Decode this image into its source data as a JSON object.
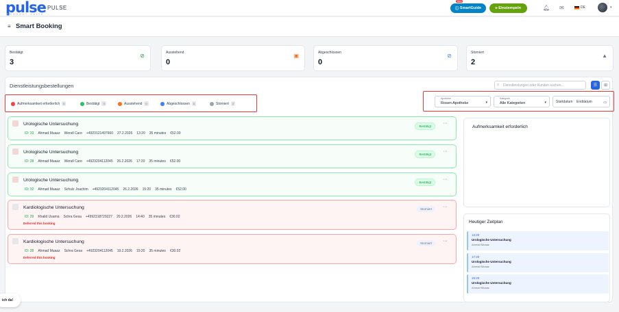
{
  "header": {
    "logo": "pulse",
    "logo_sub": "PRODUCT SUITE",
    "app_name": "PULSE",
    "new_badge": "Neu",
    "smartguide_label": "SmartGuide",
    "einstempeln_label": "Einstempeln",
    "language": "DE",
    "page_title": "Smart Booking"
  },
  "stats": [
    {
      "label": "Bestätigt",
      "value": "3",
      "icon": "check-circle-icon",
      "color": "#16a34a"
    },
    {
      "label": "Ausstehend",
      "value": "0",
      "icon": "calendar-pending-icon",
      "color": "#f97316"
    },
    {
      "label": "Abgeschlossen",
      "value": "0",
      "icon": "check-circle-icon",
      "color": "#3b82f6"
    },
    {
      "label": "Storniert",
      "value": "2",
      "icon": "warning-triangle-icon",
      "color": "#6b7280"
    }
  ],
  "section": {
    "title": "Dienstleistungsbestellungen",
    "search_placeholder": "Dienstleistungen oder Kunden suchen..."
  },
  "legend": [
    {
      "label": "Aufmerksamkeit erforderlich",
      "count": "0",
      "color": "#ef4444"
    },
    {
      "label": "Bestätigt",
      "count": "3",
      "color": "#22c55e"
    },
    {
      "label": "Ausstehend",
      "count": "0",
      "color": "#f97316"
    },
    {
      "label": "Abgeschlossen",
      "count": "0",
      "color": "#3b82f6"
    },
    {
      "label": "Storniert",
      "count": "2",
      "color": "#9ca3af"
    }
  ],
  "filters": {
    "pharmacy_label": "Apotheke",
    "pharmacy_value": "Rosen Apotheke",
    "category_label": "Kategorie",
    "category_value": "Alle Kategorien",
    "start_placeholder": "Startdatum",
    "end_placeholder": "Enddatum"
  },
  "bookings": [
    {
      "title": "Urologische Untersuchung",
      "id": "ID: 33",
      "user": "Ahmad Muaaz",
      "patient": "Wendl Caro",
      "phone": "+4923121497660",
      "date": "27.2.2026",
      "time": "13:20",
      "duration": "35 minutes",
      "price": "€52.00",
      "status": "Bestätigt",
      "note": ""
    },
    {
      "title": "Urologische Untersuchung",
      "id": "ID: 38",
      "user": "Ahmad Muaaz",
      "patient": "Wendl Caro",
      "phone": "+4923204112045",
      "date": "26.2.2026",
      "time": "17:20",
      "duration": "35 minutes",
      "price": "€52.00",
      "status": "Bestätigt",
      "note": ""
    },
    {
      "title": "Urologische Untersuchung",
      "id": "ID: 32",
      "user": "Ahmad Muaaz",
      "patient": "Schulz Joachim",
      "phone": "+4923204112045",
      "date": "26.2.2026",
      "time": "15:20",
      "duration": "35 minutes",
      "price": "€52.00",
      "status": "Bestätigt",
      "note": ""
    },
    {
      "title": "Kardiologische Untersuchung",
      "id": "ID: 29",
      "user": "Khalid Usama",
      "patient": "Schra Gesa",
      "phone": "+4992318729227",
      "date": "20.2.2026",
      "time": "14:40",
      "duration": "35 minutes",
      "price": "€30.02",
      "status": "Storniert",
      "note": "Deferred this booking"
    },
    {
      "title": "Kardiologische Untersuchung",
      "id": "ID: 28",
      "user": "Ahmad Muaaz",
      "patient": "Schra Gesa",
      "phone": "+4923204112045",
      "date": "19.2.2026",
      "time": "15:20",
      "duration": "35 minutes",
      "price": "€30.02",
      "status": "Storniert",
      "note": "Deferred this booking"
    }
  ],
  "attention_panel": {
    "title": "Aufmerksamkeit erforderlich"
  },
  "schedule": {
    "title": "Heutiger Zeitplan",
    "events": [
      {
        "time": "13:20",
        "service": "Urologische Untersuchung",
        "person": "Ahmad Muaaz"
      },
      {
        "time": "17:20",
        "service": "Urologische Untersuchung",
        "person": "Ahmad Muaaz"
      },
      {
        "time": "15:20",
        "service": "Urologische Untersuchung",
        "person": "Ahmad Muaaz"
      }
    ]
  },
  "chat_label": "ich da!"
}
